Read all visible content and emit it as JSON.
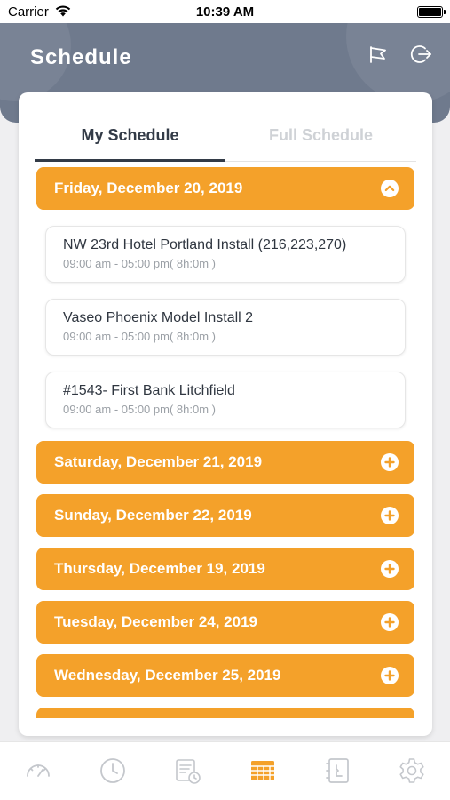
{
  "status_bar": {
    "carrier": "Carrier",
    "time": "10:39 AM"
  },
  "header": {
    "title": "Schedule",
    "icons": [
      "megaphone-icon",
      "logout-icon"
    ]
  },
  "tabs": [
    {
      "label": "My Schedule",
      "active": true
    },
    {
      "label": "Full Schedule",
      "active": false
    }
  ],
  "days": [
    {
      "label": "Friday, December 20, 2019",
      "expanded": true,
      "entries": [
        {
          "title": "NW 23rd Hotel Portland Install (216,223,270)",
          "time": "09:00 am - 05:00 pm( 8h:0m )"
        },
        {
          "title": "Vaseo Phoenix Model Install 2",
          "time": "09:00 am - 05:00 pm( 8h:0m )"
        },
        {
          "title": "#1543- First Bank Litchfield",
          "time": "09:00 am - 05:00 pm( 8h:0m )"
        }
      ]
    },
    {
      "label": "Saturday, December 21, 2019",
      "expanded": false
    },
    {
      "label": "Sunday, December 22, 2019",
      "expanded": false
    },
    {
      "label": "Thursday, December 19, 2019",
      "expanded": false
    },
    {
      "label": "Tuesday, December 24, 2019",
      "expanded": false
    },
    {
      "label": "Wednesday, December 25, 2019",
      "expanded": false
    }
  ],
  "bottom_nav": [
    {
      "name": "dashboard-gauge-icon",
      "active": false
    },
    {
      "name": "clock-icon",
      "active": false
    },
    {
      "name": "timesheet-icon",
      "active": false
    },
    {
      "name": "schedule-grid-icon",
      "active": true
    },
    {
      "name": "contacts-book-icon",
      "active": false
    },
    {
      "name": "settings-gear-icon",
      "active": false
    }
  ],
  "colors": {
    "header": "#6f7a8d",
    "accent": "#f4a12a",
    "nav_active": "#f4a12a",
    "nav_inactive": "#c4c7cc"
  }
}
